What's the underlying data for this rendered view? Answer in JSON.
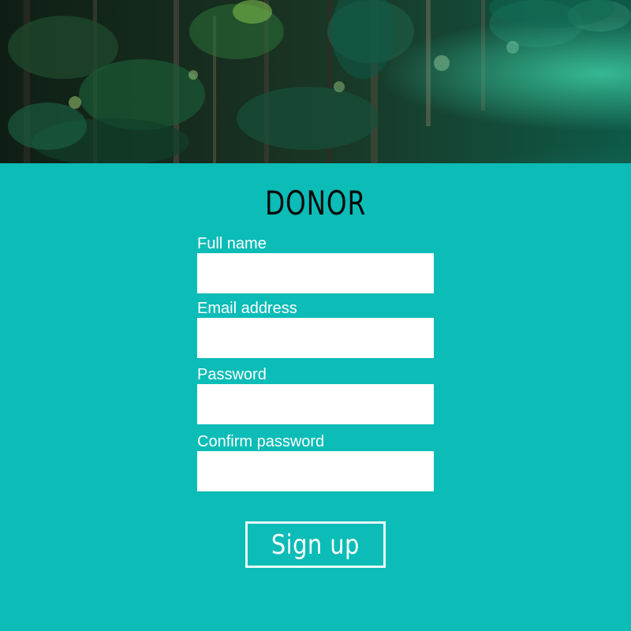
{
  "title": "DONOR",
  "form": {
    "fields": [
      {
        "label": "Full name",
        "value": "",
        "placeholder": ""
      },
      {
        "label": "Email address",
        "value": "",
        "placeholder": ""
      },
      {
        "label": "Password",
        "value": "",
        "placeholder": ""
      },
      {
        "label": "Confirm password",
        "value": "",
        "placeholder": ""
      }
    ],
    "submit_label": "Sign up"
  },
  "colors": {
    "background": "#0bbcb7",
    "input_background": "#ffffff",
    "title_text": "#0a0a0a",
    "label_text": "#ffffff",
    "button_border": "#e8fbfa"
  }
}
